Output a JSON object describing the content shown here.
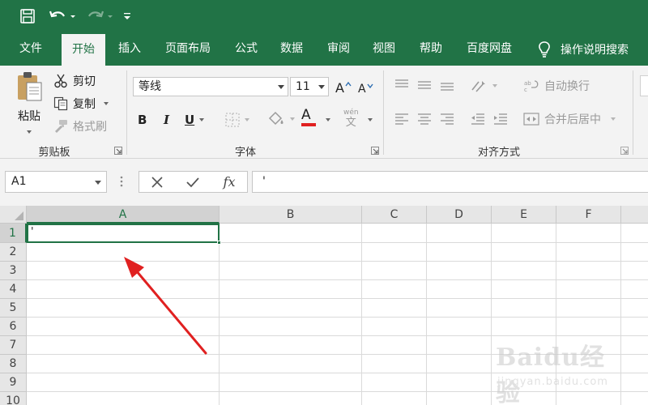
{
  "tabs": [
    {
      "label": "文件"
    },
    {
      "label": "开始"
    },
    {
      "label": "插入"
    },
    {
      "label": "页面布局"
    },
    {
      "label": "公式"
    },
    {
      "label": "数据"
    },
    {
      "label": "审阅"
    },
    {
      "label": "视图"
    },
    {
      "label": "帮助"
    },
    {
      "label": "百度网盘"
    }
  ],
  "active_tab": "开始",
  "tell_me": "操作说明搜索",
  "clipboard": {
    "paste": "粘贴",
    "cut": "剪切",
    "copy": "复制",
    "format_painter": "格式刷",
    "group_label": "剪贴板"
  },
  "font": {
    "font_name": "等线",
    "font_size": "11",
    "bold": "B",
    "italic": "I",
    "underline": "U",
    "font_color_letter": "A",
    "grow": "A",
    "shrink": "A",
    "phonetic": "wén",
    "phonetic_char": "文",
    "group_label": "字体",
    "font_color": "#e02020"
  },
  "alignment": {
    "wrap_text": "自动换行",
    "merge_center": "合并后居中",
    "group_label": "对齐方式"
  },
  "formula_bar": {
    "name_box": "A1",
    "fx": "fx",
    "value": "'"
  },
  "sheet": {
    "columns": [
      "A",
      "B",
      "C",
      "D",
      "E",
      "F"
    ],
    "rows": [
      "1",
      "2",
      "3",
      "4",
      "5",
      "6",
      "7",
      "8",
      "9",
      "10"
    ],
    "selected_cell": "A1",
    "a1_value": "'",
    "accent": "#217346"
  },
  "watermark": {
    "brand": "Baidu经验",
    "url": "jingyan.baidu.com"
  },
  "colors": {
    "brand_green": "#217346",
    "annotation_arrow": "#e02020"
  }
}
